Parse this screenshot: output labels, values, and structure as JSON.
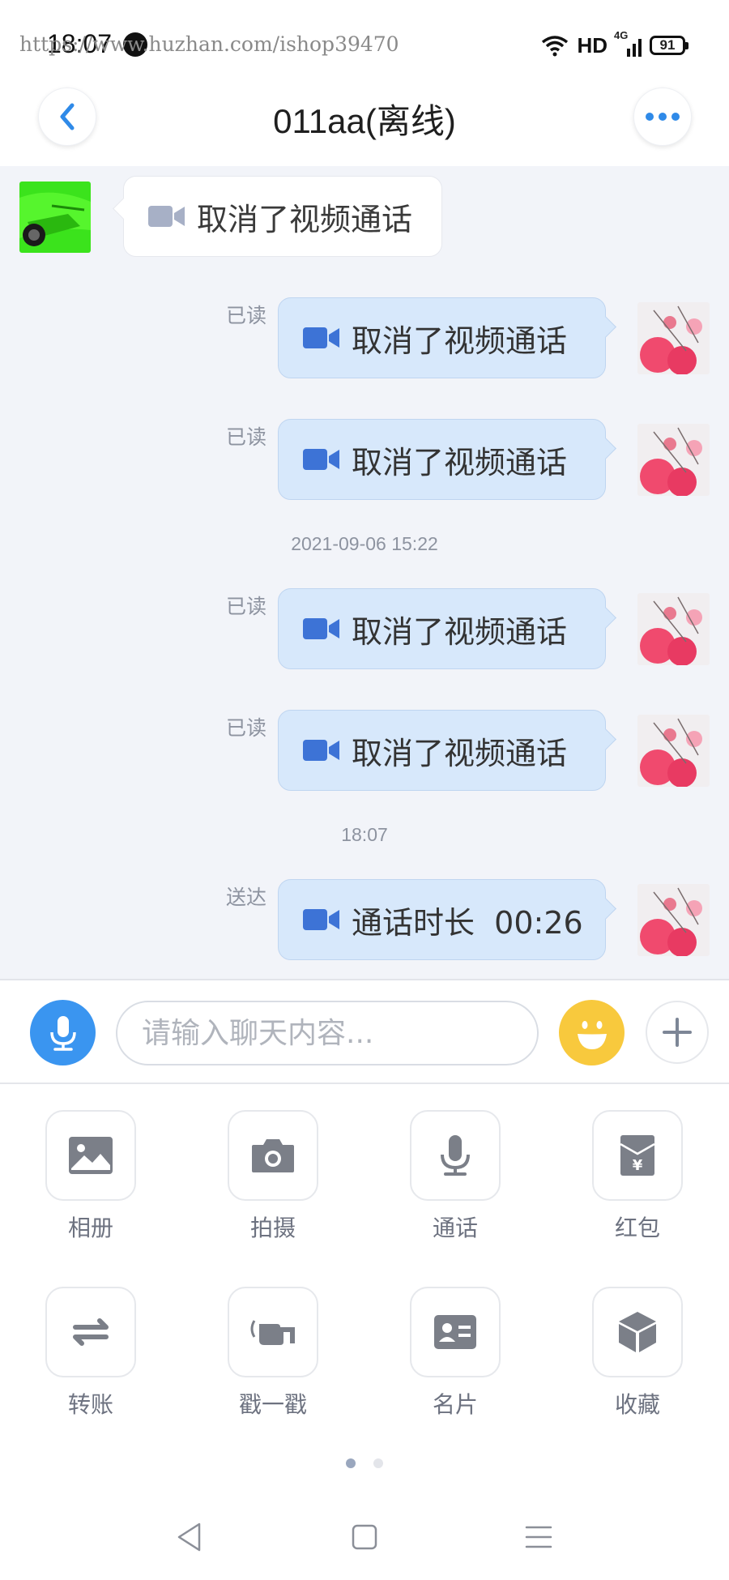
{
  "status_bar": {
    "time": "18:07",
    "watermark": "https://www.huzhan.com/ishop39470",
    "network": "HD",
    "signal_type": "4G",
    "battery": "91"
  },
  "header": {
    "title": "011aa(离线)",
    "back_icon": "chevron-left-icon",
    "more_icon": "more-dots-icon"
  },
  "chat": {
    "messages": [
      {
        "side": "in",
        "icon": "video-camera-icon",
        "text": "取消了视频通话"
      },
      {
        "side": "out",
        "status": "已读",
        "icon": "video-camera-icon",
        "text": "取消了视频通话"
      },
      {
        "side": "out",
        "status": "已读",
        "icon": "video-camera-icon",
        "text": "取消了视频通话"
      },
      {
        "type": "timestamp",
        "text": "2021-09-06 15:22"
      },
      {
        "side": "out",
        "status": "已读",
        "icon": "video-camera-icon",
        "text": "取消了视频通话"
      },
      {
        "side": "out",
        "status": "已读",
        "icon": "video-camera-icon",
        "text": "取消了视频通话"
      },
      {
        "type": "timestamp",
        "text": "18:07"
      },
      {
        "side": "out",
        "status": "送达",
        "icon": "video-camera-icon",
        "text": "通话时长  00:26"
      }
    ]
  },
  "input_bar": {
    "placeholder": "请输入聊天内容..."
  },
  "tools": [
    {
      "label": "相册",
      "icon": "image-icon"
    },
    {
      "label": "拍摄",
      "icon": "camera-icon"
    },
    {
      "label": "通话",
      "icon": "microphone-icon"
    },
    {
      "label": "红包",
      "icon": "red-packet-icon"
    },
    {
      "label": "转账",
      "icon": "transfer-icon"
    },
    {
      "label": "戳一戳",
      "icon": "poke-hand-icon"
    },
    {
      "label": "名片",
      "icon": "contact-card-icon"
    },
    {
      "label": "收藏",
      "icon": "favorite-box-icon"
    }
  ],
  "pager": {
    "pages": 2,
    "current": 1
  },
  "colors": {
    "accent_blue": "#3a95f0",
    "video_icon_out": "#3d73d6",
    "video_icon_in": "#a7b0c6",
    "bubble_out": "#d7e8fb",
    "chat_bg": "#f2f4f9",
    "emoji_yellow": "#f8c93d"
  }
}
